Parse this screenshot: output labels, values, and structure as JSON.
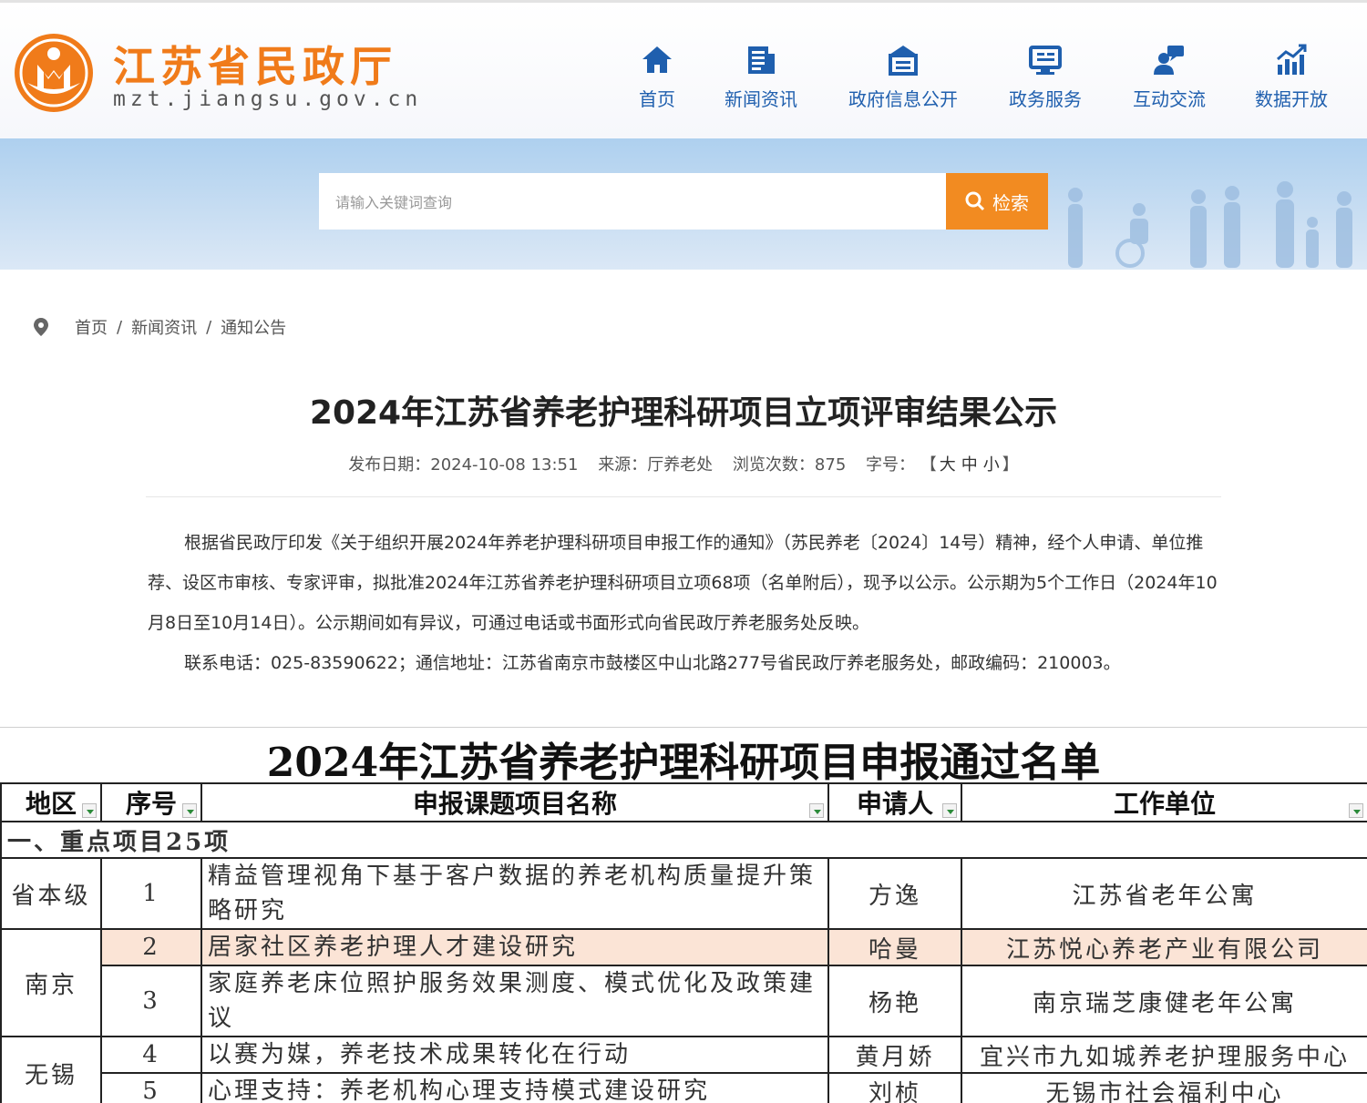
{
  "site": {
    "name": "江苏省民政厅",
    "domain": "mzt.jiangsu.gov.cn",
    "brand_color": "#f07b1a",
    "nav_color": "#1f5fae"
  },
  "nav": [
    {
      "label": "首页",
      "icon": "home-icon"
    },
    {
      "label": "新闻资讯",
      "icon": "news-icon"
    },
    {
      "label": "政府信息公开",
      "icon": "government-info-icon"
    },
    {
      "label": "政务服务",
      "icon": "service-monitor-icon"
    },
    {
      "label": "互动交流",
      "icon": "interaction-icon"
    },
    {
      "label": "数据开放",
      "icon": "data-chart-icon"
    }
  ],
  "search": {
    "placeholder": "请输入关键词查询",
    "button_label": "检索"
  },
  "breadcrumb": [
    "首页",
    "新闻资讯",
    "通知公告"
  ],
  "article": {
    "title": "2024年江苏省养老护理科研项目立项评审结果公示",
    "meta": {
      "date_label": "发布日期：",
      "date": "2024-10-08 13:51",
      "source_label": "来源：",
      "source": "厅养老处",
      "views_label": "浏览次数：",
      "views": "875",
      "font_label": "字号：",
      "font_open": "【",
      "font_sizes": [
        "大",
        "中",
        "小"
      ],
      "font_close": "】"
    },
    "paragraphs": [
      "根据省民政厅印发《关于组织开展2024年养老护理科研项目申报工作的通知》（苏民养老〔2024〕14号）精神，经个人申请、单位推荐、设区市审核、专家评审，拟批准2024年江苏省养老护理科研项目立项68项（名单附后），现予以公示。公示期为5个工作日（2024年10月8日至10月14日）。公示期间如有异议，可通过电话或书面形式向省民政厅养老服务处反映。",
      "联系电话：025-83590622；通信地址：江苏省南京市鼓楼区中山北路277号省民政厅养老服务处，邮政编码：210003。"
    ]
  },
  "sheet": {
    "title": "2024年江苏省养老护理科研项目申报通过名单",
    "headers": [
      "地区",
      "序号",
      "申报课题项目名称",
      "申请人",
      "工作单位"
    ],
    "section": "一、重点项目25项",
    "highlight_color": "#fbe4d6",
    "rows": [
      {
        "region": "省本级",
        "no": "1",
        "name_lines": [
          "精益管理视角下基于客户数据的养老机构质量提升策",
          "略研究"
        ],
        "applicant": "方逸",
        "unit": "江苏省老年公寓"
      },
      {
        "region": "南京",
        "no": "2",
        "name_lines": [
          "居家社区养老护理人才建设研究"
        ],
        "applicant": "哈曼",
        "unit": "江苏悦心养老产业有限公司"
      },
      {
        "region": "",
        "no": "3",
        "name_lines": [
          "家庭养老床位照护服务效果测度、模式优化及政策建",
          "议"
        ],
        "applicant": "杨艳",
        "unit": "南京瑞芝康健老年公寓"
      },
      {
        "region": "无锡",
        "no": "4",
        "name_lines": [
          "以赛为媒，养老技术成果转化在行动"
        ],
        "applicant": "黄月娇",
        "unit": "宜兴市九如城养老护理服务中心"
      },
      {
        "region": "",
        "no": "5",
        "name_lines": [
          "心理支持：养老机构心理支持模式建设研究"
        ],
        "applicant": "刘桢",
        "unit": "无锡市社会福利中心"
      }
    ]
  }
}
